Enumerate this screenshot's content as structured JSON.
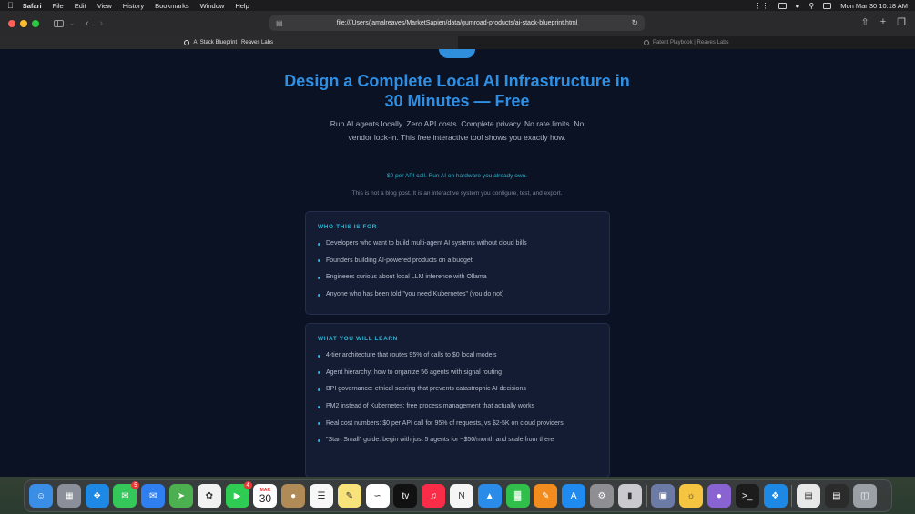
{
  "menubar": {
    "app": "Safari",
    "items": [
      "File",
      "Edit",
      "View",
      "History",
      "Bookmarks",
      "Window",
      "Help"
    ],
    "clock": "Mon Mar 30  10:18 AM"
  },
  "browser": {
    "url": "file:///Users/jamalreaves/MarketSapien/data/gumroad-products/ai-stack-blueprint.html",
    "tabs": [
      {
        "title": "AI Stack Blueprint | Reaves Labs",
        "active": true
      },
      {
        "title": "Patent Playbook | Reaves Labs",
        "active": false
      }
    ]
  },
  "page": {
    "title": "Design a Complete Local AI Infrastructure in 30 Minutes — Free",
    "subtitle": "Run AI agents locally. Zero API costs. Complete privacy. No rate limits. No vendor lock-in. This free interactive tool shows you exactly how.",
    "tagline": "$0 per API call. Run AI on hardware you already own.",
    "note": "This is not a blog post. It is an interactive system you configure, test, and export.",
    "who": {
      "title": "WHO THIS IS FOR",
      "items": [
        "Developers who want to build multi-agent AI systems without cloud bills",
        "Founders building AI-powered products on a budget",
        "Engineers curious about local LLM inference with Ollama",
        "Anyone who has been told \"you need Kubernetes\" (you do not)"
      ]
    },
    "learn": {
      "title": "WHAT YOU WILL LEARN",
      "items": [
        "4-tier architecture that routes 95% of calls to $0 local models",
        "Agent hierarchy: how to organize 56 agents with signal routing",
        "BPI governance: ethical scoring that prevents catastrophic AI decisions",
        "PM2 instead of Kubernetes: free process management that actually works",
        "Real cost numbers: $0 per API call for 95% of requests, vs $2-5K on cloud providers",
        "\"Start Small\" guide: begin with just 5 agents for ~$50/month and scale from there"
      ]
    }
  },
  "dock": {
    "calendar_month": "MAR",
    "calendar_day": "30",
    "messages_badge": "5",
    "facetime_badge": "4",
    "apps": [
      {
        "name": "finder",
        "color": "#3a8ee6"
      },
      {
        "name": "launchpad",
        "color": "#8a8f99"
      },
      {
        "name": "safari",
        "color": "#1e88e5"
      },
      {
        "name": "messages",
        "color": "#34c759"
      },
      {
        "name": "mail",
        "color": "#2f7ff0"
      },
      {
        "name": "maps",
        "color": "#4caf50"
      },
      {
        "name": "photos",
        "color": "#f2f2f2"
      },
      {
        "name": "facetime",
        "color": "#2ecc52"
      },
      {
        "name": "calendar",
        "color": "#ffffff"
      },
      {
        "name": "contacts",
        "color": "#b08a57"
      },
      {
        "name": "reminders",
        "color": "#f7f7f7"
      },
      {
        "name": "notes",
        "color": "#f8e27a"
      },
      {
        "name": "freeform",
        "color": "#ffffff"
      },
      {
        "name": "tv",
        "color": "#111111"
      },
      {
        "name": "music",
        "color": "#fa2d48"
      },
      {
        "name": "news",
        "color": "#f5f5f5"
      },
      {
        "name": "keynote",
        "color": "#2b8be8"
      },
      {
        "name": "numbers",
        "color": "#2fbf4a"
      },
      {
        "name": "pages",
        "color": "#f28c1e"
      },
      {
        "name": "app-store",
        "color": "#1f8bf0"
      },
      {
        "name": "system-settings",
        "color": "#8e8e93"
      },
      {
        "name": "iphone-mirroring",
        "color": "#c9c9cf"
      },
      {
        "name": "preview",
        "color": "#6c7aa6"
      },
      {
        "name": "tips",
        "color": "#f5c542"
      },
      {
        "name": "github-desktop",
        "color": "#8a63d2"
      },
      {
        "name": "terminal",
        "color": "#1c1c1c"
      },
      {
        "name": "safari-2",
        "color": "#1e88e5"
      },
      {
        "name": "documents",
        "color": "#e8e8e8"
      },
      {
        "name": "screenshot",
        "color": "#2b2b2b"
      },
      {
        "name": "trash",
        "color": "#9aa0a6"
      }
    ]
  }
}
